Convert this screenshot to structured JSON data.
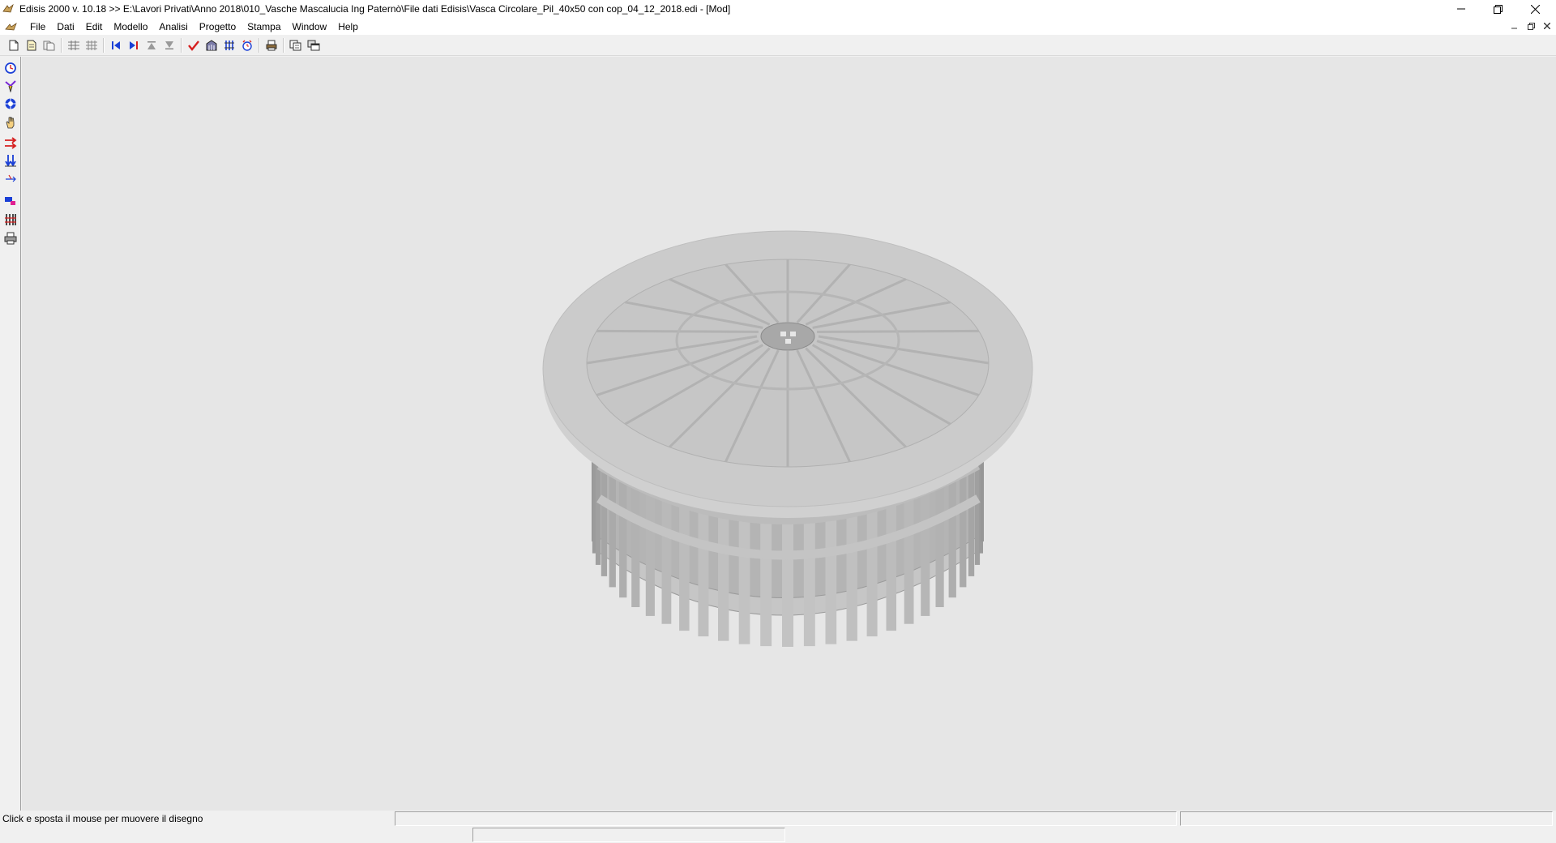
{
  "window": {
    "title": "Edisis 2000 v. 10.18 >> E:\\Lavori Privati\\Anno 2018\\010_Vasche Mascalucia Ing Paternò\\File dati Edisis\\Vasca Circolare_Pil_40x50 con cop_04_12_2018.edi - [Mod]"
  },
  "menu": {
    "items": [
      "File",
      "Dati",
      "Edit",
      "Modello",
      "Analisi",
      "Progetto",
      "Stampa",
      "Window",
      "Help"
    ]
  },
  "toolbar": {
    "icons": [
      "new-file-icon",
      "open-file-icon",
      "save-file-icon",
      "grid-icon",
      "grid-alt-icon",
      "first-record-icon",
      "last-record-icon",
      "move-up-icon",
      "move-down-icon",
      "check-icon",
      "building-icon",
      "columns-icon",
      "clock-icon",
      "printer-icon",
      "copy-icon",
      "window-icon"
    ]
  },
  "sidebar": {
    "icons": [
      "rotate-icon",
      "select-icon",
      "orbit-icon",
      "hand-pan-icon",
      "arrows-horizontal-icon",
      "arrows-vertical-icon",
      "axis-icon",
      "render-icon",
      "bars-icon",
      "print-icon"
    ]
  },
  "colors": {
    "canvas": "#e6e6e6",
    "model": "#c2c2c2",
    "accent_red": "#d62020",
    "accent_blue": "#1a3fd6"
  },
  "status": {
    "message": "Click e sposta il mouse per muovere il disegno",
    "panel2": "",
    "panel3": "",
    "panel4": ""
  }
}
